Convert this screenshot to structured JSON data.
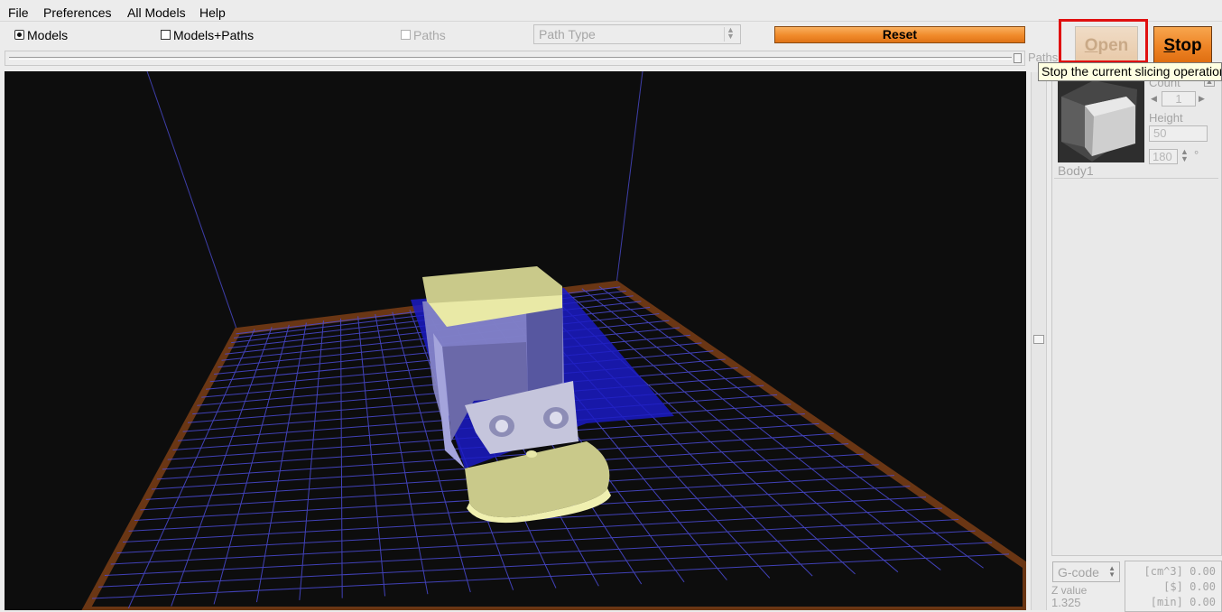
{
  "menubar": {
    "items": [
      "File",
      "Preferences",
      "All Models",
      "Help"
    ]
  },
  "toolbar": {
    "models_label": "Models",
    "models_selected": true,
    "models_paths_label": "Models+Paths",
    "paths_label": "Paths",
    "path_type_placeholder": "Path Type",
    "reset_label": "Reset",
    "open_label": "Open",
    "stop_label": "Stop"
  },
  "slider": {
    "label": "Paths"
  },
  "tooltip": {
    "text": "Stop the current slicing operation"
  },
  "right_panel": {
    "body": {
      "name": "Body1",
      "count_label": "Count",
      "count_value": "1",
      "height_label": "Height",
      "height_value": "50",
      "rotation_value": "180",
      "degree_symbol": "°"
    }
  },
  "status": {
    "gcode_label": "G-code",
    "z_label": "Z value",
    "z_value": "1.325",
    "stats": [
      {
        "unit": "[cm^3]",
        "value": "0.00"
      },
      {
        "unit": "[$]",
        "value": "0.00"
      },
      {
        "unit": "[min]",
        "value": "0.00"
      }
    ]
  },
  "colors": {
    "accent_orange": "#ee8425",
    "highlight_red": "#e01010",
    "viewport_bg": "#0d0d0d",
    "grid_line": "#4a4ad0",
    "bed_border": "#7a3f12",
    "model_top": "#c9c98a"
  }
}
